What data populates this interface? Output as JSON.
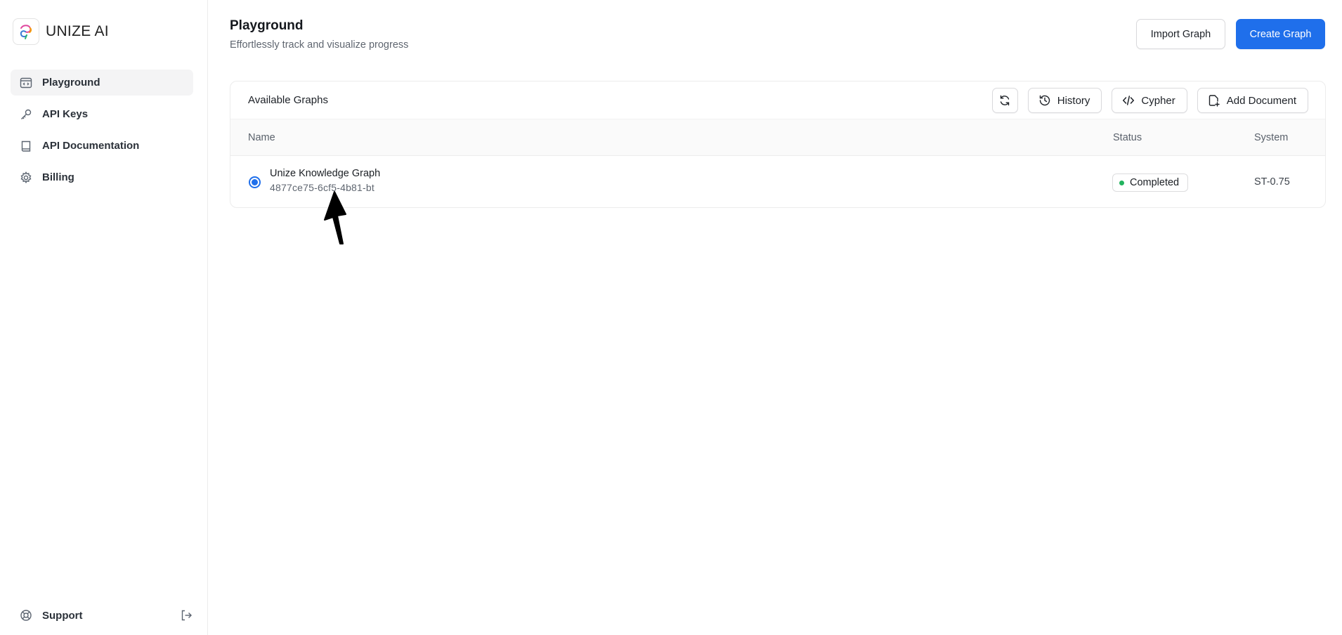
{
  "brand": {
    "name": "UNIZE AI"
  },
  "sidebar": {
    "items": [
      {
        "label": "Playground",
        "icon": "playground-icon",
        "active": true
      },
      {
        "label": "API Keys",
        "icon": "key-icon",
        "active": false
      },
      {
        "label": "API Documentation",
        "icon": "book-icon",
        "active": false
      },
      {
        "label": "Billing",
        "icon": "gear-icon",
        "active": false
      }
    ],
    "support_label": "Support"
  },
  "header": {
    "title": "Playground",
    "subtitle": "Effortlessly track and visualize progress",
    "import_label": "Import Graph",
    "create_label": "Create Graph"
  },
  "card": {
    "title": "Available Graphs",
    "toolbar": {
      "history_label": "History",
      "cypher_label": "Cypher",
      "add_document_label": "Add Document"
    },
    "columns": {
      "name": "Name",
      "status": "Status",
      "system": "System"
    },
    "rows": [
      {
        "name": "Unize Knowledge Graph",
        "id": "4877ce75-6cf5-4b81-bt",
        "status": "Completed",
        "system": "ST-0.75",
        "selected": true
      }
    ]
  },
  "colors": {
    "accent": "#1f6feb",
    "status_completed": "#22b35e"
  }
}
